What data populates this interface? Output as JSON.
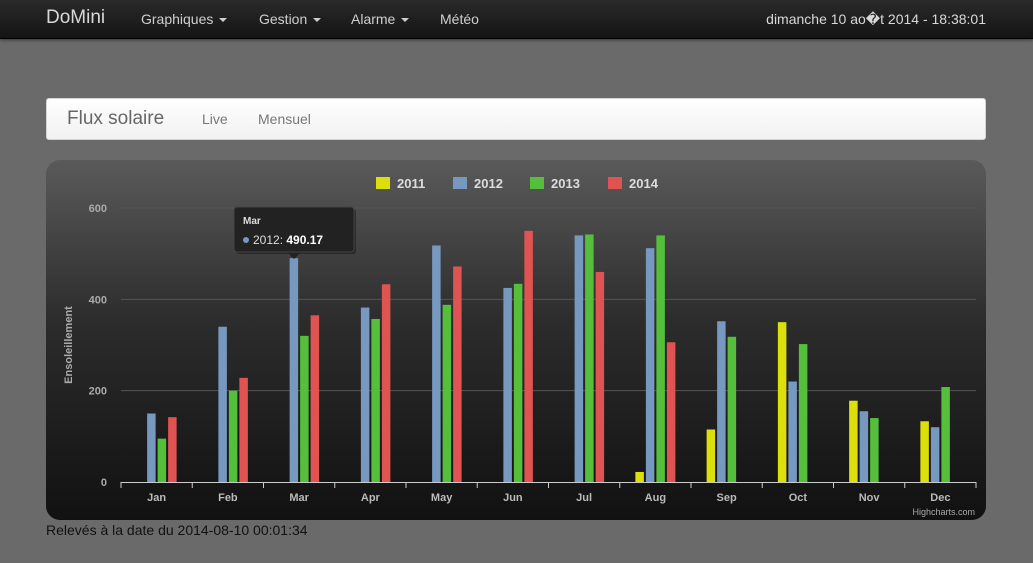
{
  "navbar": {
    "brand": "DoMini",
    "items": [
      {
        "label": "Graphiques",
        "dropdown": true
      },
      {
        "label": "Gestion",
        "dropdown": true
      },
      {
        "label": "Alarme",
        "dropdown": true
      },
      {
        "label": "Météo",
        "dropdown": false
      }
    ],
    "datetime": "dimanche 10 ao�t 2014 - 18:38:01"
  },
  "subnav": {
    "title": "Flux solaire",
    "links": [
      "Live",
      "Mensuel"
    ]
  },
  "footer": {
    "text": "Relevés à la date du 2014-08-10 00:01:34"
  },
  "credits": "Highcharts.com",
  "tooltip": {
    "category": "Mar",
    "series": "2012",
    "value": "490.17"
  },
  "chart_data": {
    "type": "bar",
    "ylabel": "Ensoleillement",
    "xlabel": "",
    "ylim": [
      0,
      600
    ],
    "yticks": [
      0,
      200,
      400,
      600
    ],
    "grid": true,
    "legend": "top-center",
    "categories": [
      "Jan",
      "Feb",
      "Mar",
      "Apr",
      "May",
      "Jun",
      "Jul",
      "Aug",
      "Sep",
      "Oct",
      "Nov",
      "Dec"
    ],
    "series": [
      {
        "name": "2011",
        "color": "#dddf0d",
        "values": [
          null,
          null,
          null,
          null,
          null,
          null,
          null,
          22,
          115,
          350,
          178,
          133
        ]
      },
      {
        "name": "2012",
        "color": "#7798bf",
        "values": [
          150,
          340,
          490.17,
          382,
          518,
          425,
          540,
          512,
          352,
          220,
          155,
          120
        ]
      },
      {
        "name": "2013",
        "color": "#55bf3b",
        "values": [
          95,
          200,
          320,
          357,
          388,
          434,
          542,
          540,
          318,
          302,
          140,
          208
        ]
      },
      {
        "name": "2014",
        "color": "#df5353",
        "values": [
          142,
          228,
          365,
          433,
          472,
          550,
          460,
          306,
          null,
          null,
          null,
          null
        ]
      }
    ]
  }
}
